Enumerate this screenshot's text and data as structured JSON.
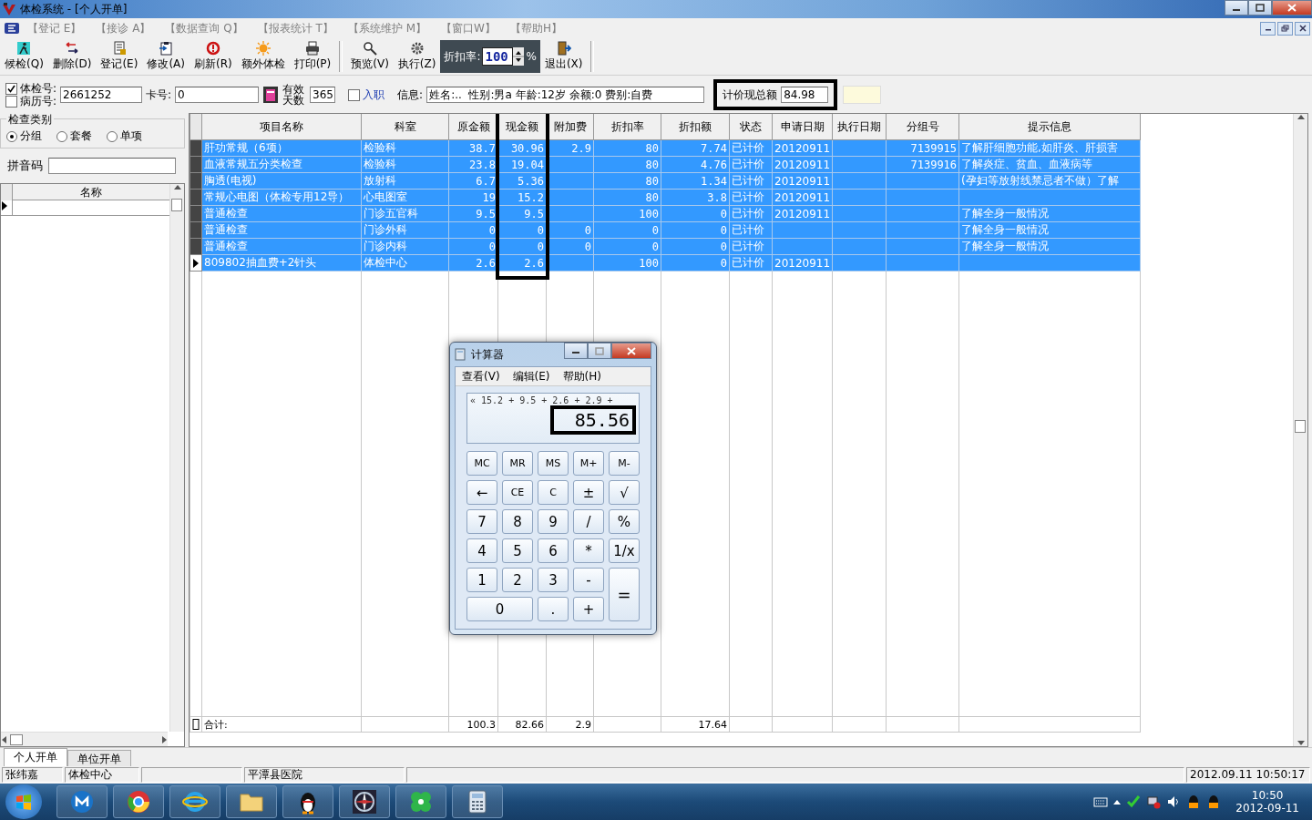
{
  "window": {
    "title": "体检系统 - [个人开单]"
  },
  "menus": [
    {
      "label": "【登记 E】",
      "disabled": true
    },
    {
      "label": "【接诊 A】",
      "disabled": true
    },
    {
      "label": "【数据查询 Q】",
      "disabled": true
    },
    {
      "label": "【报表统计 T】",
      "disabled": true
    },
    {
      "label": "【系统维护 M】",
      "disabled": true
    },
    {
      "label": "【窗口W】",
      "disabled": true
    },
    {
      "label": "【帮助H】",
      "disabled": true
    }
  ],
  "toolbar": {
    "left": [
      {
        "label": "候检(Q)",
        "kind": "walker"
      },
      {
        "label": "删除(D)",
        "kind": "arrows"
      },
      {
        "label": "登记(E)",
        "kind": "register"
      },
      {
        "label": "修改(A)",
        "kind": "edit"
      },
      {
        "label": "刷新(R)",
        "kind": "refresh"
      },
      {
        "label": "额外体检",
        "kind": "sun"
      },
      {
        "label": "打印(P)",
        "kind": "printer"
      }
    ],
    "middle": [
      {
        "label": "预览(V)",
        "kind": "magnifier"
      },
      {
        "label": "执行(Z)",
        "kind": "gear"
      }
    ],
    "discount": {
      "label": "折扣率:",
      "value": "100",
      "unit": "%"
    },
    "right": [
      {
        "label": "退出(X)",
        "kind": "exit"
      }
    ]
  },
  "info": {
    "id_options": [
      {
        "label": "体检号:",
        "checked": true
      },
      {
        "label": "病历号:",
        "checked": false
      }
    ],
    "id_value": "2661252",
    "card_label": "卡号:",
    "card_value": "0",
    "days_label": "有效天数",
    "days_value": "365",
    "entry": {
      "label": "入职",
      "checked": false
    },
    "info_label": "信息:",
    "info_value": "姓名:..  性别:男a 年龄:12岁 余额:0 费别:自费",
    "total_label": "计价现总额",
    "total_value": "84.98"
  },
  "left_panel": {
    "group_title": "检查类别",
    "options": [
      {
        "label": "分组",
        "selected": true
      },
      {
        "label": "套餐",
        "selected": false
      },
      {
        "label": "单项",
        "selected": false
      }
    ],
    "pinyin_label": "拼音码",
    "list_header": "名称"
  },
  "table": {
    "columns": [
      {
        "label": "项目名称"
      },
      {
        "label": "科室"
      },
      {
        "label": "原金额"
      },
      {
        "label": "现金额"
      },
      {
        "label": "附加费"
      },
      {
        "label": "折扣率"
      },
      {
        "label": "折扣额"
      },
      {
        "label": "状态"
      },
      {
        "label": "申请日期"
      },
      {
        "label": "执行日期"
      },
      {
        "label": "分组号"
      },
      {
        "label": "提示信息"
      }
    ],
    "rows": [
      {
        "selected": true,
        "current": false,
        "cells": [
          "肝功常规（6项）",
          "检验科",
          "38.7",
          "30.96",
          "2.9",
          "80",
          "7.74",
          "已计价",
          "20120911",
          null,
          "7139915",
          "了解肝细胞功能,如肝炎、肝损害"
        ]
      },
      {
        "selected": true,
        "current": false,
        "cells": [
          "血液常规五分类检查",
          "检验科",
          "23.8",
          "19.04",
          null,
          "80",
          "4.76",
          "已计价",
          "20120911",
          null,
          "7139916",
          "了解炎症、贫血、血液病等"
        ]
      },
      {
        "selected": true,
        "current": false,
        "cells": [
          "胸透(电视)",
          "放射科",
          "6.7",
          "5.36",
          null,
          "80",
          "1.34",
          "已计价",
          "20120911",
          null,
          null,
          "(孕妇等放射线禁忌者不做）了解"
        ]
      },
      {
        "selected": true,
        "current": false,
        "cells": [
          "常规心电图（体检专用12导）",
          "心电图室",
          "19",
          "15.2",
          null,
          "80",
          "3.8",
          "已计价",
          "20120911",
          null,
          null,
          null
        ]
      },
      {
        "selected": true,
        "current": false,
        "cells": [
          "普通检查",
          "门诊五官科",
          "9.5",
          "9.5",
          null,
          "100",
          "0",
          "已计价",
          "20120911",
          null,
          null,
          "了解全身一般情况"
        ]
      },
      {
        "selected": true,
        "current": false,
        "cells": [
          "普通检查",
          "门诊外科",
          "0",
          "0",
          "0",
          "0",
          "0",
          "已计价",
          null,
          null,
          null,
          "了解全身一般情况"
        ]
      },
      {
        "selected": true,
        "current": false,
        "cells": [
          "普通检查",
          "门诊内科",
          "0",
          "0",
          "0",
          "0",
          "0",
          "已计价",
          null,
          null,
          null,
          "了解全身一般情况"
        ]
      },
      {
        "selected": true,
        "current": true,
        "cells": [
          "809802抽血费+2针头",
          "体检中心",
          "2.6",
          "2.6",
          null,
          "100",
          "0",
          "已计价",
          "20120911",
          null,
          null,
          null
        ]
      }
    ],
    "totals": {
      "column_1": "合计:",
      "column_3": "100.3",
      "column_4": "82.66",
      "column_5": "2.9",
      "column_7": "17.64"
    }
  },
  "tabs": [
    {
      "label": "个人开单",
      "selected": true
    },
    {
      "label": "单位开单",
      "selected": false
    }
  ],
  "status_bar": {
    "pane_1": "张纬嘉",
    "pane_2": "体检中心",
    "pane_4": "平潭县医院",
    "pane_6": "2012.09.11 10:50:17"
  },
  "calculator": {
    "title": "计算器",
    "menus": [
      "查看(V)",
      "编辑(E)",
      "帮助(H)"
    ],
    "history": "« 15.2 + 9.5 + 2.6 + 2.9 +",
    "display": "85.56",
    "keys": [
      {
        "label": "MC",
        "kind": "small"
      },
      {
        "label": "MR",
        "kind": "small"
      },
      {
        "label": "MS",
        "kind": "small"
      },
      {
        "label": "M+",
        "kind": "small"
      },
      {
        "label": "M-",
        "kind": "small"
      },
      {
        "label": "←",
        "kind": "key"
      },
      {
        "label": "CE",
        "kind": "small"
      },
      {
        "label": "C",
        "kind": "small"
      },
      {
        "label": "±",
        "kind": "key"
      },
      {
        "label": "√",
        "kind": "key"
      },
      {
        "label": "7",
        "kind": "key"
      },
      {
        "label": "8",
        "kind": "key"
      },
      {
        "label": "9",
        "kind": "key"
      },
      {
        "label": "/",
        "kind": "key"
      },
      {
        "label": "%",
        "kind": "key"
      },
      {
        "label": "4",
        "kind": "key"
      },
      {
        "label": "5",
        "kind": "key"
      },
      {
        "label": "6",
        "kind": "key"
      },
      {
        "label": "*",
        "kind": "key"
      },
      {
        "label": "1/x",
        "kind": "key"
      },
      {
        "label": "1",
        "kind": "key"
      },
      {
        "label": "2",
        "kind": "key"
      },
      {
        "label": "3",
        "kind": "key"
      },
      {
        "label": "-",
        "kind": "key"
      },
      {
        "label": "=",
        "kind": "tall"
      },
      {
        "label": "0",
        "kind": "wide"
      },
      {
        "label": ".",
        "kind": "key"
      },
      {
        "label": "+",
        "kind": "key"
      }
    ]
  },
  "taskbar": {
    "apps": [
      {
        "kind": "m-circle"
      },
      {
        "kind": "ball"
      },
      {
        "kind": "e-letter"
      },
      {
        "kind": "folder"
      },
      {
        "kind": "penguin"
      },
      {
        "kind": "compass"
      },
      {
        "kind": "clover"
      },
      {
        "kind": "calculator"
      }
    ],
    "time": "10:50",
    "date": "2012-09-11"
  }
}
